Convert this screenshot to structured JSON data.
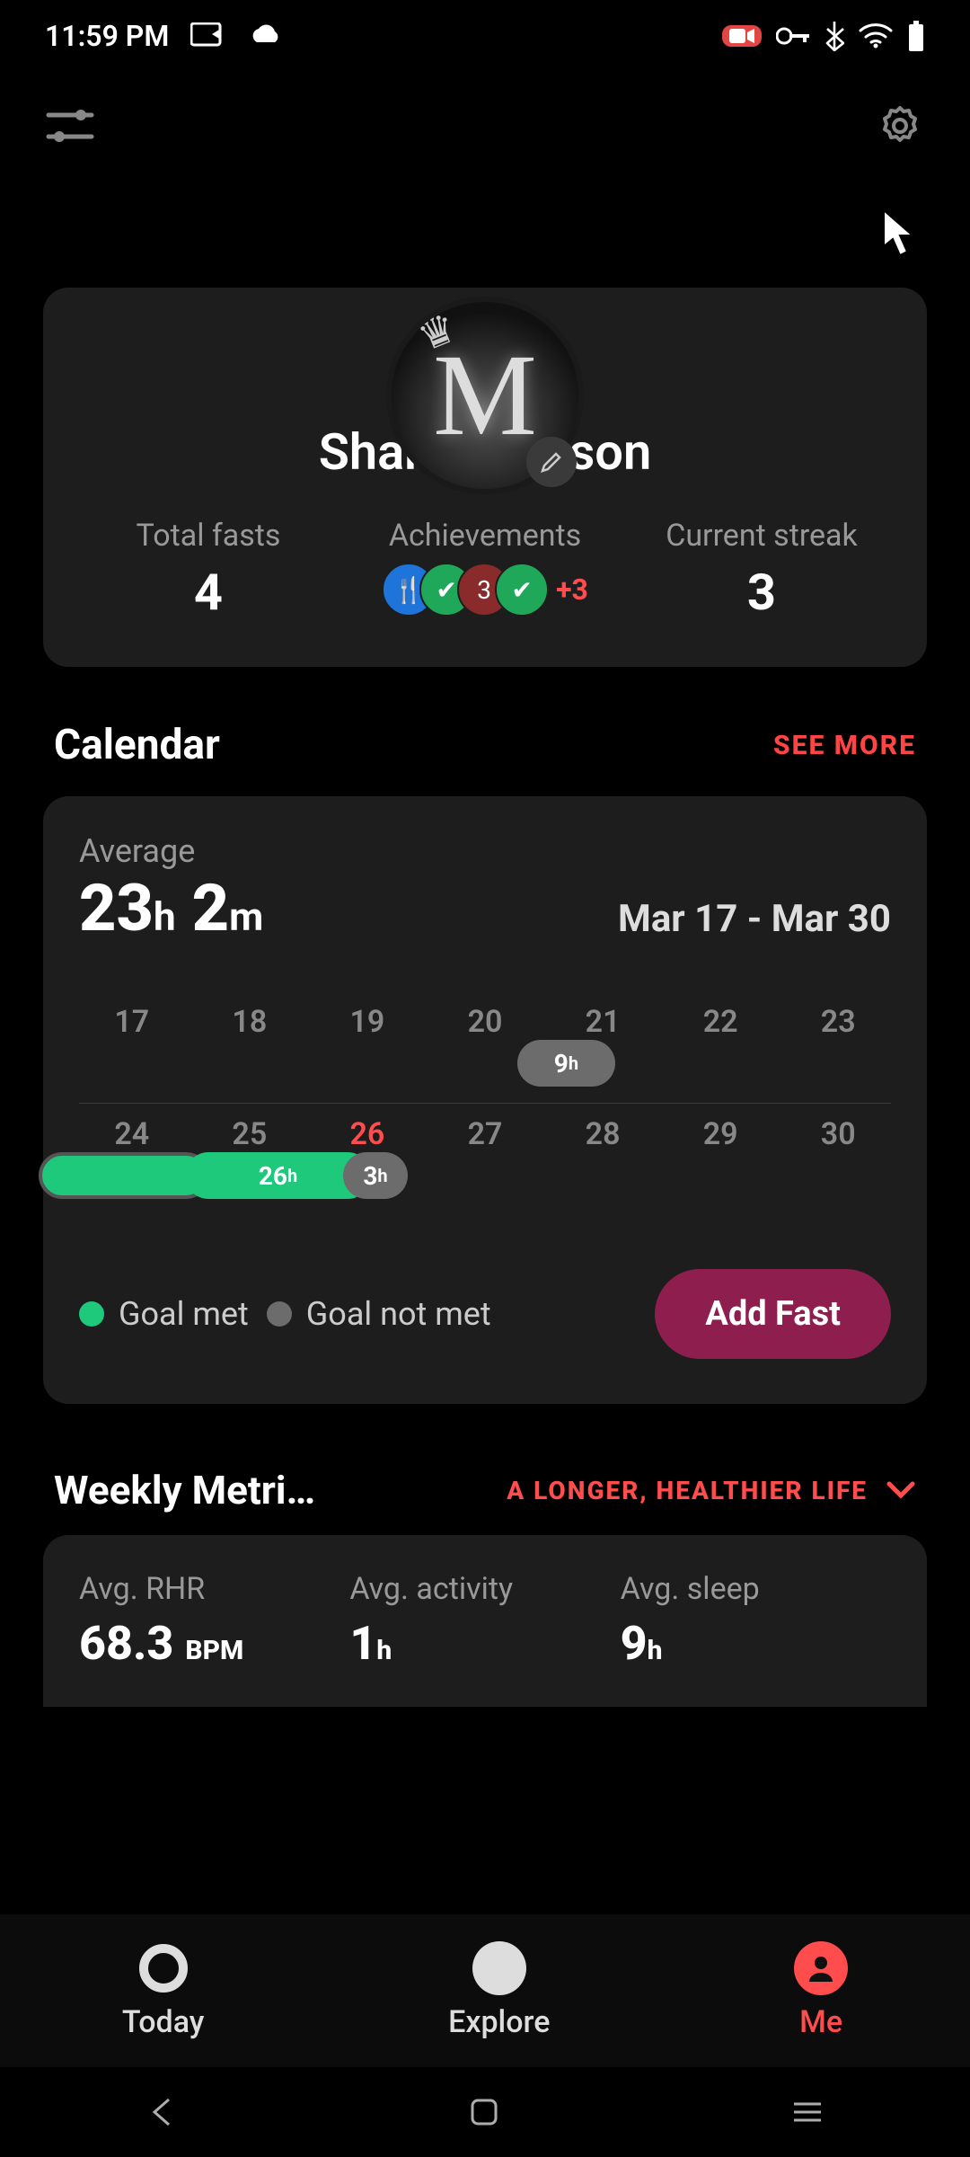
{
  "status": {
    "time": "11:59 PM"
  },
  "profile": {
    "name": "Shane Dawson",
    "avatar_letter": "M",
    "stats": {
      "total_fasts": {
        "label": "Total fasts",
        "value": "4"
      },
      "achievements": {
        "label": "Achievements",
        "more": "+3"
      },
      "streak": {
        "label": "Current streak",
        "value": "3"
      }
    }
  },
  "calendar": {
    "title": "Calendar",
    "see_more": "SEE MORE",
    "average_label": "Average",
    "average_hours": "23",
    "average_minutes": "2",
    "range": "Mar 17 - Mar 30",
    "row1": [
      "17",
      "18",
      "19",
      "20",
      "21",
      "22",
      "23"
    ],
    "row2": [
      "24",
      "25",
      "26",
      "27",
      "28",
      "29",
      "30"
    ],
    "today": "26",
    "pills": {
      "p21": "9",
      "p25": "26",
      "p26": "3"
    },
    "legend_met": "Goal met",
    "legend_notmet": "Goal not met",
    "add_fast": "Add Fast"
  },
  "weekly": {
    "title": "Weekly Metri…",
    "tagline": "A LONGER, HEALTHIER LIFE",
    "rhr": {
      "label": "Avg. RHR",
      "value": "68.3",
      "unit": "BPM"
    },
    "activity": {
      "label": "Avg. activity",
      "value": "1",
      "unit": "h"
    },
    "sleep": {
      "label": "Avg. sleep",
      "value": "9",
      "unit": "h"
    }
  },
  "nav": {
    "today": "Today",
    "explore": "Explore",
    "me": "Me"
  },
  "colors": {
    "accent": "#ff4d4d",
    "green": "#1ec97b",
    "card": "#1d1d1d",
    "add_fast_bg": "#8e1e4e"
  }
}
